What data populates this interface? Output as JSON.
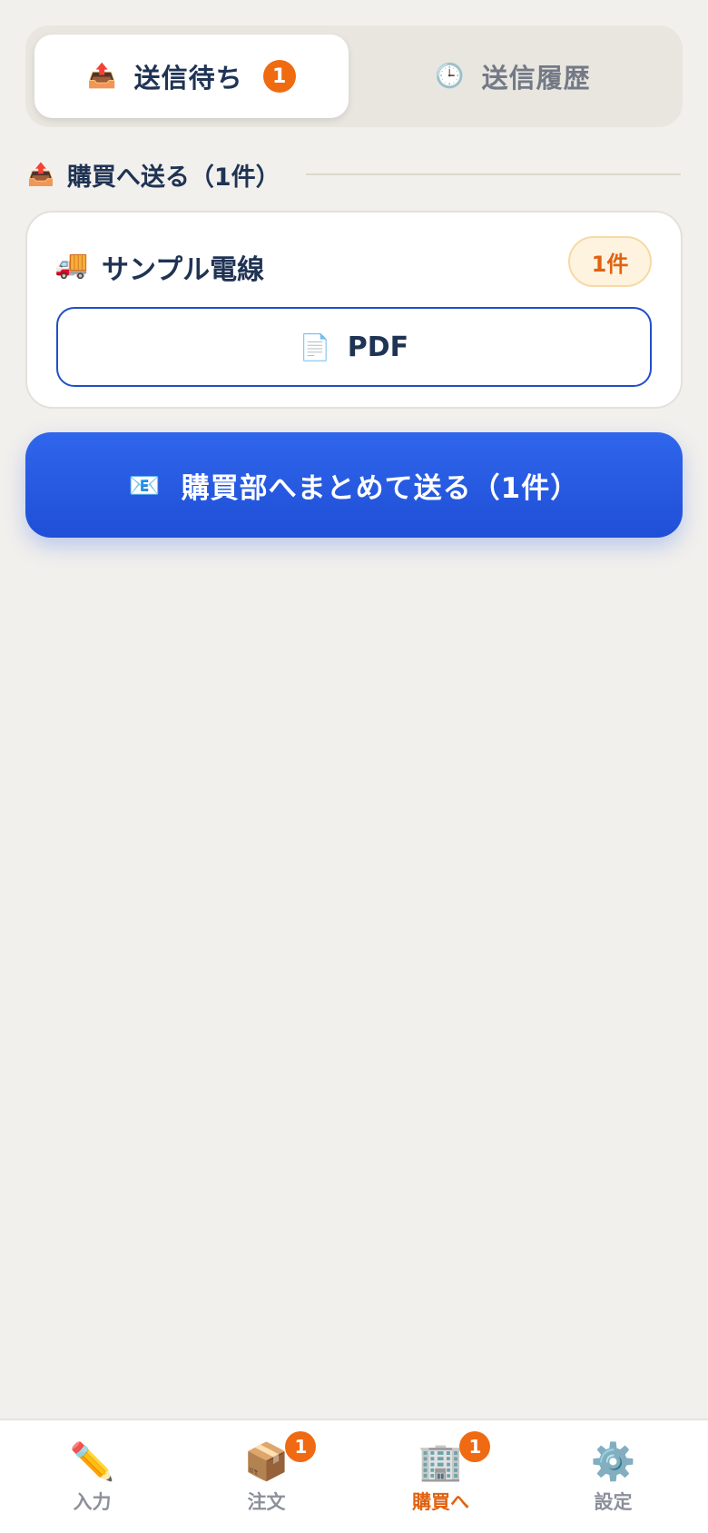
{
  "tabs": {
    "pending": {
      "icon": "outbox-tray-icon",
      "glyph": "📤",
      "label": "送信待ち",
      "count": "1"
    },
    "history": {
      "icon": "clock-icon",
      "glyph": "🕒",
      "label": "送信履歴"
    }
  },
  "section": {
    "icon": "outbox-tray-icon",
    "glyph": "📤",
    "title": "購買へ送る（1件）"
  },
  "card": {
    "supplier_icon": "delivery-truck-icon",
    "supplier_glyph": "🚚",
    "supplier_name": "サンプル電線",
    "count_label": "1件",
    "pdf_icon": "document-icon",
    "pdf_glyph": "📄",
    "pdf_label": "PDF"
  },
  "send_button": {
    "icon": "envelope-icon",
    "glyph": "📧",
    "label": "購買部へまとめて送る（1件）"
  },
  "bottom_nav": {
    "items": [
      {
        "icon": "pencil-icon",
        "glyph": "✏️",
        "label": "入力",
        "badge": ""
      },
      {
        "icon": "package-icon",
        "glyph": "📦",
        "label": "注文",
        "badge": "1"
      },
      {
        "icon": "office-building-icon",
        "glyph": "🏢",
        "label": "購買へ",
        "badge": "1",
        "active": true
      },
      {
        "icon": "gear-icon",
        "glyph": "⚙️",
        "label": "設定",
        "badge": ""
      }
    ]
  },
  "colors": {
    "accent": "#2f66ec",
    "badge": "#ef6a12",
    "active_nav": "#e2620f",
    "background": "#f2f0ec"
  }
}
